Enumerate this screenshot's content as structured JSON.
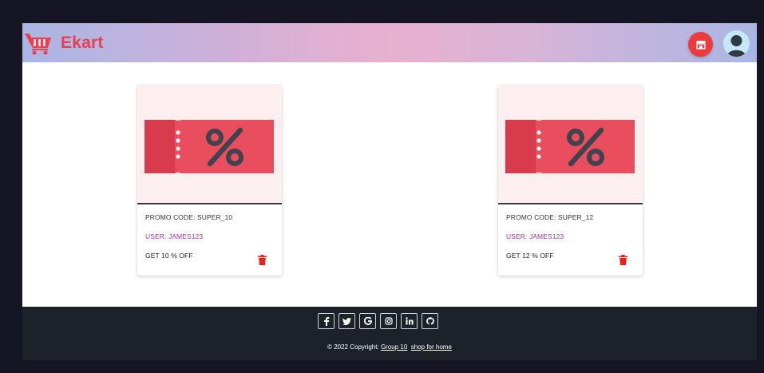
{
  "app": {
    "brand": "Ekart"
  },
  "header": {
    "icons": [
      "shopping-cart-icon",
      "store-icon",
      "user-avatar-icon"
    ]
  },
  "promos": [
    {
      "code": "PROMO CODE: SUPER_10",
      "user": "USER: JAMES123",
      "discount": "GET 10 % OFF",
      "icon": "coupon-icon"
    },
    {
      "code": "PROMO CODE: SUPER_12",
      "user": "USER: JAMES123",
      "discount": "GET 12 % OFF",
      "icon": "coupon-icon"
    }
  ],
  "footer": {
    "social": [
      "f",
      "t",
      "G",
      "ig",
      "in",
      "gh"
    ],
    "social_icons": [
      "facebook-icon",
      "twitter-icon",
      "google-icon",
      "instagram-icon",
      "linkedin-icon",
      "github-icon"
    ],
    "copyright": "© 2022 Copyright:",
    "link1": "Group 10",
    "link2": "shop for home"
  },
  "colors": {
    "brand": "#e8404f",
    "coupon": "#e94e5e",
    "footer": "#1d2128"
  }
}
